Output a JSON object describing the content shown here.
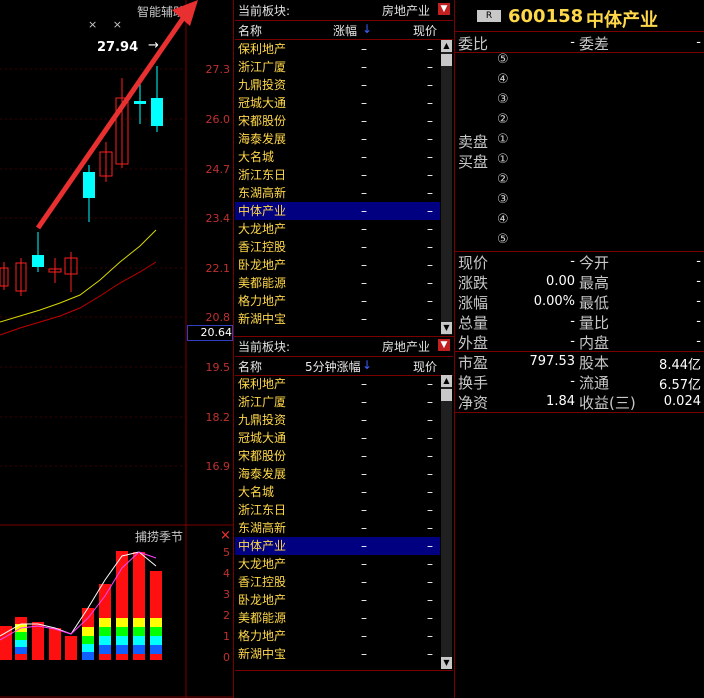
{
  "chart": {
    "title": "智能辅助",
    "price_note": "27.94",
    "arrow": "→",
    "marks": "× ×",
    "yticks": [
      "27.3",
      "26.0",
      "24.7",
      "23.4",
      "22.1",
      "20.8",
      "19.5",
      "18.2",
      "16.9"
    ],
    "current_price": "20.64",
    "ind_title": "捕捞季节",
    "ind_close": "×",
    "ind_yticks": [
      "5",
      "4",
      "3",
      "2",
      "1",
      "0"
    ]
  },
  "list_top": {
    "head_label": "当前板块:",
    "sector": "房地产业",
    "col_name": "名称",
    "col_change": "涨幅",
    "col_price": "现价",
    "rows": [
      {
        "name": "保利地产",
        "change": "–",
        "price": "–"
      },
      {
        "name": "浙江广厦",
        "change": "–",
        "price": "–"
      },
      {
        "name": "九鼎投资",
        "change": "–",
        "price": "–"
      },
      {
        "name": "冠城大通",
        "change": "–",
        "price": "–"
      },
      {
        "name": "宋都股份",
        "change": "–",
        "price": "–"
      },
      {
        "name": "海泰发展",
        "change": "–",
        "price": "–"
      },
      {
        "name": "大名城",
        "change": "–",
        "price": "–"
      },
      {
        "name": "浙江东日",
        "change": "–",
        "price": "–"
      },
      {
        "name": "东湖高新",
        "change": "–",
        "price": "–"
      },
      {
        "name": "中体产业",
        "change": "–",
        "price": "–"
      },
      {
        "name": "大龙地产",
        "change": "–",
        "price": "–"
      },
      {
        "name": "香江控股",
        "change": "–",
        "price": "–"
      },
      {
        "name": "卧龙地产",
        "change": "–",
        "price": "–"
      },
      {
        "name": "美都能源",
        "change": "–",
        "price": "–"
      },
      {
        "name": "格力地产",
        "change": "–",
        "price": "–"
      },
      {
        "name": "新湖中宝",
        "change": "–",
        "price": "–"
      }
    ]
  },
  "list_bottom": {
    "head_label": "当前板块:",
    "sector": "房地产业",
    "col_name": "名称",
    "col_change": "5分钟涨幅",
    "col_price": "现价",
    "rows": [
      {
        "name": "保利地产",
        "change": "–",
        "price": "–"
      },
      {
        "name": "浙江广厦",
        "change": "–",
        "price": "–"
      },
      {
        "name": "九鼎投资",
        "change": "–",
        "price": "–"
      },
      {
        "name": "冠城大通",
        "change": "–",
        "price": "–"
      },
      {
        "name": "宋都股份",
        "change": "–",
        "price": "–"
      },
      {
        "name": "海泰发展",
        "change": "–",
        "price": "–"
      },
      {
        "name": "大名城",
        "change": "–",
        "price": "–"
      },
      {
        "name": "浙江东日",
        "change": "–",
        "price": "–"
      },
      {
        "name": "东湖高新",
        "change": "–",
        "price": "–"
      },
      {
        "name": "中体产业",
        "change": "–",
        "price": "–"
      },
      {
        "name": "大龙地产",
        "change": "–",
        "price": "–"
      },
      {
        "name": "香江控股",
        "change": "–",
        "price": "–"
      },
      {
        "name": "卧龙地产",
        "change": "–",
        "price": "–"
      },
      {
        "name": "美都能源",
        "change": "–",
        "price": "–"
      },
      {
        "name": "格力地产",
        "change": "–",
        "price": "–"
      },
      {
        "name": "新湖中宝",
        "change": "–",
        "price": "–"
      }
    ]
  },
  "quote": {
    "badge": "R",
    "code": "600158",
    "name": "中体产业",
    "weibi": "委比",
    "weibi_val": "-",
    "weicha": "委差",
    "weicha_val": "-",
    "sell_label": "卖盘",
    "buy_label": "买盘",
    "sell_levels": [
      "⑤",
      "④",
      "③",
      "②",
      "①"
    ],
    "buy_levels": [
      "①",
      "②",
      "③",
      "④",
      "⑤"
    ],
    "rows": [
      {
        "l1": "现价",
        "v1": "-",
        "l2": "今开",
        "v2": "-"
      },
      {
        "l1": "涨跌",
        "v1": "0.00",
        "l2": "最高",
        "v2": "-"
      },
      {
        "l1": "涨幅",
        "v1": "0.00%",
        "l2": "最低",
        "v2": "-"
      },
      {
        "l1": "总量",
        "v1": "-",
        "l2": "量比",
        "v2": "-"
      },
      {
        "l1": "外盘",
        "v1": "-",
        "l2": "内盘",
        "v2": "-"
      },
      {
        "l1": "市盈",
        "v1": "797.53",
        "l2": "股本",
        "v2": "8.44亿"
      },
      {
        "l1": "换手",
        "v1": "-",
        "l2": "流通",
        "v2": "6.57亿"
      },
      {
        "l1": "净资",
        "v1": "1.84",
        "l2": "收益(三)",
        "v2": "0.024"
      }
    ]
  },
  "colors": {
    "up": "#ff2020",
    "down": "#00ffff",
    "grid": "#7a0000",
    "accent": "#ffd84a"
  }
}
